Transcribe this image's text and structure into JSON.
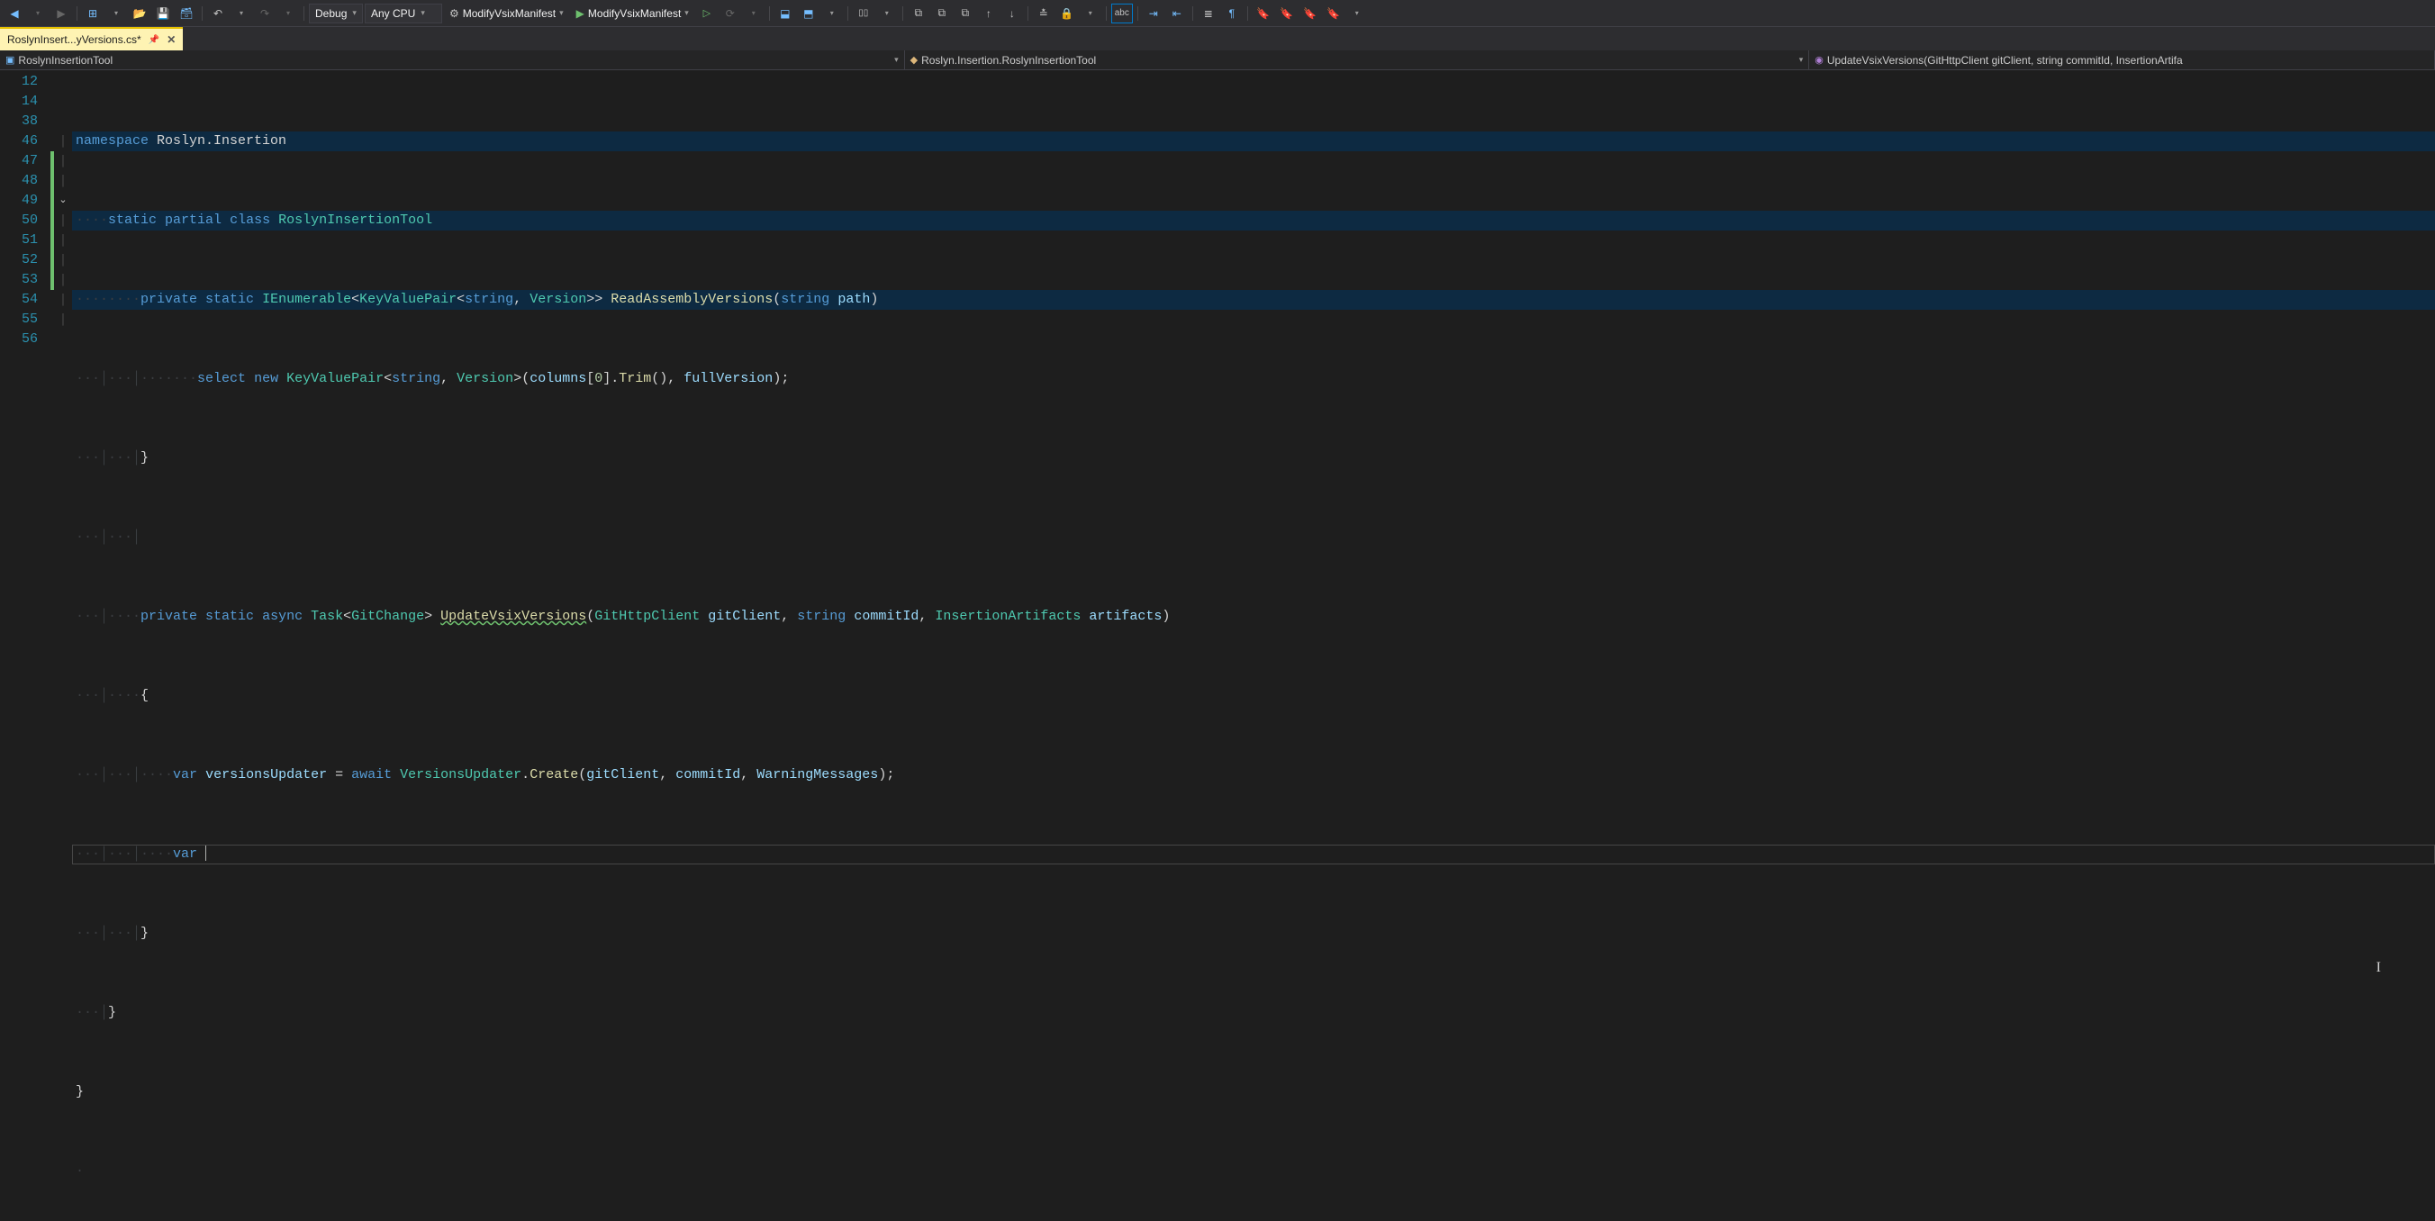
{
  "toolbar": {
    "config_dropdown": "Debug",
    "platform_dropdown": "Any CPU",
    "start_target_1": "ModifyVsixManifest",
    "start_target_2": "ModifyVsixManifest"
  },
  "tab": {
    "filename": "RoslynInsert...yVersions.cs*"
  },
  "navbar": {
    "project": "RoslynInsertionTool",
    "type": "Roslyn.Insertion.RoslynInsertionTool",
    "member": "UpdateVsixVersions(GitHttpClient gitClient, string commitId, InsertionArtifa"
  },
  "line_numbers": [
    "12",
    "14",
    "38",
    "46",
    "47",
    "48",
    "49",
    "50",
    "51",
    "52",
    "53",
    "54",
    "55",
    "56"
  ],
  "code": {
    "l12": {
      "kw": "namespace",
      "ns": "Roslyn.Insertion"
    },
    "l14": {
      "kw1": "static",
      "kw2": "partial",
      "kw3": "class",
      "ty": "RoslynInsertionTool"
    },
    "l38": {
      "kw1": "private",
      "kw2": "static",
      "ty1": "IEnumerable",
      "ty2": "KeyValuePair",
      "kw3": "string",
      "ty3": "Version",
      "mth": "ReadAssemblyVersions",
      "kw4": "string",
      "par": "path"
    },
    "l46": {
      "kw1": "select",
      "kw2": "new",
      "ty1": "KeyValuePair",
      "kw3": "string",
      "ty2": "Version",
      "par1": "columns",
      "num": "0",
      "mth": "Trim",
      "par2": "fullVersion"
    },
    "l47": {
      "brace": "}"
    },
    "l49": {
      "kw1": "private",
      "kw2": "static",
      "kw3": "async",
      "ty1": "Task",
      "ty2": "GitChange",
      "mth": "UpdateVsixVersions",
      "ty3": "GitHttpClient",
      "par1": "gitClient",
      "kw4": "string",
      "par2": "commitId",
      "ty4": "InsertionArtifacts",
      "par3": "artifacts"
    },
    "l50": {
      "brace": "{"
    },
    "l51": {
      "kw1": "var",
      "par1": "versionsUpdater",
      "kw2": "await",
      "ty": "VersionsUpdater",
      "mth": "Create",
      "par2": "gitClient",
      "par3": "commitId",
      "par4": "WarningMessages"
    },
    "l52": {
      "kw1": "var"
    },
    "l53": {
      "brace": "}"
    },
    "l54": {
      "brace": "}"
    },
    "l55": {
      "brace": "}"
    }
  }
}
